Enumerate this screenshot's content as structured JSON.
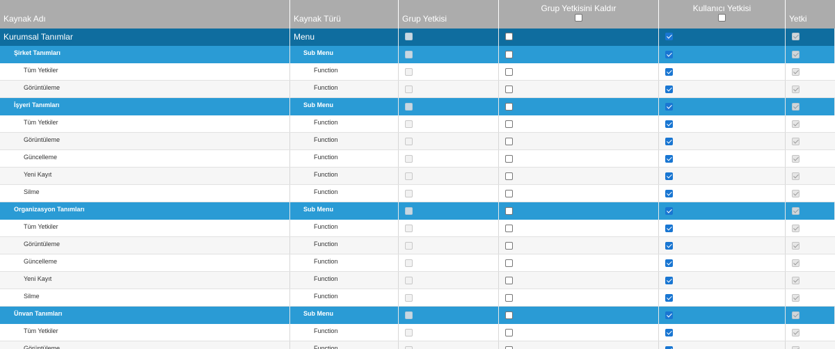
{
  "columns": {
    "resource_name": "Kaynak Adı",
    "resource_type": "Kaynak Türü",
    "group_permission": "Grup Yetkisi",
    "remove_group_permission": "Grup Yetkisini Kaldır",
    "user_permission": "Kullanıcı Yetkisi",
    "permission": "Yetki"
  },
  "header_checks": {
    "remove_group_permission_all": false,
    "user_permission_all": false
  },
  "colors": {
    "header_bg": "#acacac",
    "menu_row_bg": "#0f6d9f",
    "submenu_row_bg": "#2a9bd5",
    "checkbox_checked": "#1976d2"
  },
  "rows": [
    {
      "level": "menu",
      "name": "Kurumsal Tanımlar",
      "type": "Menu",
      "group": false,
      "remove": false,
      "user": true,
      "perm": true
    },
    {
      "level": "submenu",
      "name": "Şirket Tanımları",
      "type": "Sub Menu",
      "group": false,
      "remove": false,
      "user": true,
      "perm": true
    },
    {
      "level": "func",
      "name": "Tüm Yetkiler",
      "type": "Function",
      "group": false,
      "remove": false,
      "user": true,
      "perm": true
    },
    {
      "level": "func",
      "name": "Görüntüleme",
      "type": "Function",
      "group": false,
      "remove": false,
      "user": true,
      "perm": true
    },
    {
      "level": "submenu",
      "name": "İşyeri Tanımları",
      "type": "Sub Menu",
      "group": false,
      "remove": false,
      "user": true,
      "perm": true
    },
    {
      "level": "func",
      "name": "Tüm Yetkiler",
      "type": "Function",
      "group": false,
      "remove": false,
      "user": true,
      "perm": true
    },
    {
      "level": "func",
      "name": "Görüntüleme",
      "type": "Function",
      "group": false,
      "remove": false,
      "user": true,
      "perm": true
    },
    {
      "level": "func",
      "name": "Güncelleme",
      "type": "Function",
      "group": false,
      "remove": false,
      "user": true,
      "perm": true
    },
    {
      "level": "func",
      "name": "Yeni Kayıt",
      "type": "Function",
      "group": false,
      "remove": false,
      "user": true,
      "perm": true
    },
    {
      "level": "func",
      "name": "Silme",
      "type": "Function",
      "group": false,
      "remove": false,
      "user": true,
      "perm": true
    },
    {
      "level": "submenu",
      "name": "Organizasyon Tanımları",
      "type": "Sub Menu",
      "group": false,
      "remove": false,
      "user": true,
      "perm": true
    },
    {
      "level": "func",
      "name": "Tüm Yetkiler",
      "type": "Function",
      "group": false,
      "remove": false,
      "user": true,
      "perm": true
    },
    {
      "level": "func",
      "name": "Görüntüleme",
      "type": "Function",
      "group": false,
      "remove": false,
      "user": true,
      "perm": true
    },
    {
      "level": "func",
      "name": "Güncelleme",
      "type": "Function",
      "group": false,
      "remove": false,
      "user": true,
      "perm": true
    },
    {
      "level": "func",
      "name": "Yeni Kayıt",
      "type": "Function",
      "group": false,
      "remove": false,
      "user": true,
      "perm": true
    },
    {
      "level": "func",
      "name": "Silme",
      "type": "Function",
      "group": false,
      "remove": false,
      "user": true,
      "perm": true
    },
    {
      "level": "submenu",
      "name": "Ünvan Tanımları",
      "type": "Sub Menu",
      "group": false,
      "remove": false,
      "user": true,
      "perm": true
    },
    {
      "level": "func",
      "name": "Tüm Yetkiler",
      "type": "Function",
      "group": false,
      "remove": false,
      "user": true,
      "perm": true
    },
    {
      "level": "func",
      "name": "Görüntüleme",
      "type": "Function",
      "group": false,
      "remove": false,
      "user": true,
      "perm": true
    }
  ]
}
